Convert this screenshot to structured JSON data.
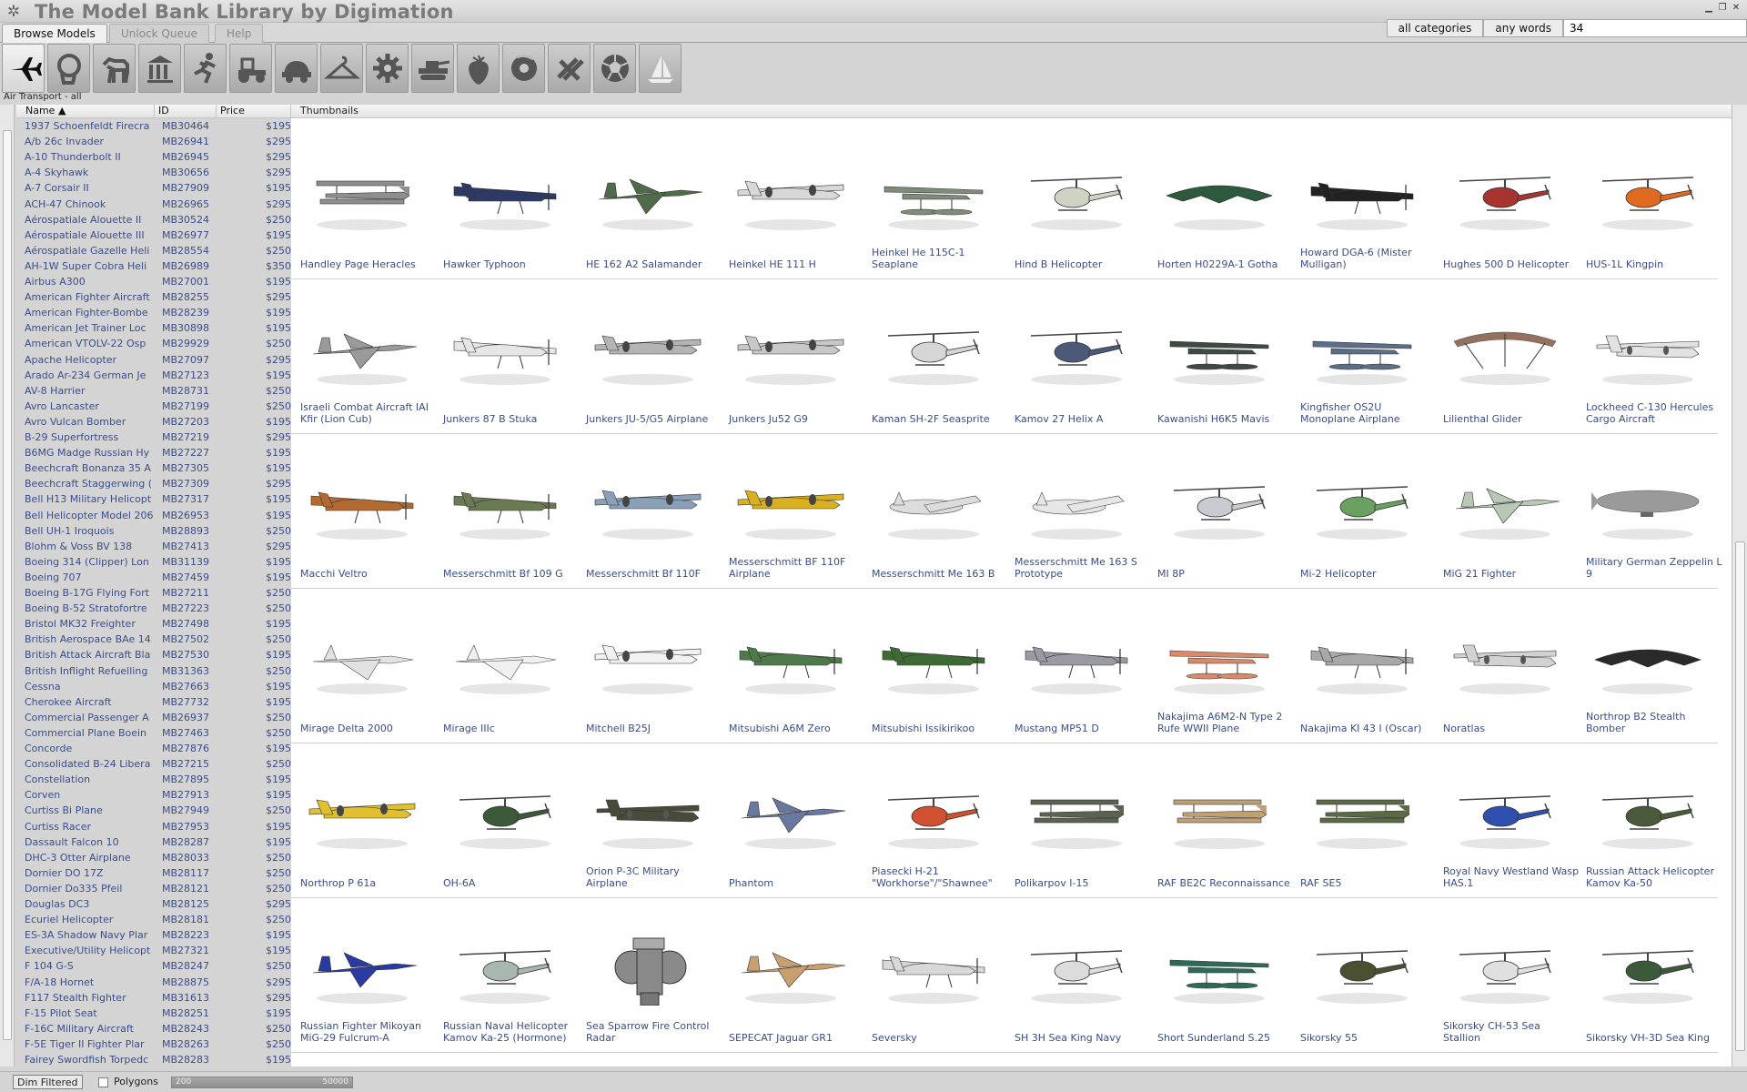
{
  "window": {
    "title": "The Model Bank Library by Digimation"
  },
  "tabs": [
    {
      "label": "Browse Models",
      "active": true
    },
    {
      "label": "Unlock Queue",
      "active": false
    },
    {
      "label": "Help",
      "active": false
    }
  ],
  "search": {
    "category": "all categories",
    "mode": "any words",
    "value": "34"
  },
  "categories": [
    {
      "icon": "airplane-icon",
      "active": true
    },
    {
      "icon": "head-icon"
    },
    {
      "icon": "horse-icon"
    },
    {
      "icon": "building-icon"
    },
    {
      "icon": "runner-icon"
    },
    {
      "icon": "tractor-icon"
    },
    {
      "icon": "car-icon"
    },
    {
      "icon": "hanger-icon"
    },
    {
      "icon": "gear-icon"
    },
    {
      "icon": "tank-icon"
    },
    {
      "icon": "strawberry-icon"
    },
    {
      "icon": "donut-icon"
    },
    {
      "icon": "tools-icon"
    },
    {
      "icon": "soccer-ball-icon"
    },
    {
      "icon": "sailboat-icon"
    }
  ],
  "category_caption": "Air Transport - all",
  "list": {
    "headers": {
      "name": "Name",
      "id": "ID",
      "price": "Price"
    },
    "rows": [
      [
        "1937 Schoenfeldt Firecra",
        "MB30464",
        "$195"
      ],
      [
        "A/b 26c Invader",
        "MB26941",
        "$295"
      ],
      [
        "A-10 Thunderbolt II",
        "MB26945",
        "$295"
      ],
      [
        "A-4 Skyhawk",
        "MB30656",
        "$295"
      ],
      [
        "A-7 Corsair II",
        "MB27909",
        "$195"
      ],
      [
        "ACH-47 Chinook",
        "MB26965",
        "$295"
      ],
      [
        "Aérospatiale Alouette II",
        "MB30524",
        "$250"
      ],
      [
        "Aérospatiale Alouette III",
        "MB26977",
        "$195"
      ],
      [
        "Aérospatiale Gazelle Heli",
        "MB28554",
        "$250"
      ],
      [
        "AH-1W Super Cobra Heli",
        "MB26989",
        "$350"
      ],
      [
        "Airbus A300",
        "MB27001",
        "$195"
      ],
      [
        "American Fighter Aircraft",
        "MB28255",
        "$295"
      ],
      [
        "American Fighter-Bombe",
        "MB28239",
        "$195"
      ],
      [
        "American Jet Trainer Loc",
        "MB30898",
        "$195"
      ],
      [
        "American VTOLV-22 Osp",
        "MB29929",
        "$250"
      ],
      [
        "Apache Helicopter",
        "MB27097",
        "$295"
      ],
      [
        "Arado Ar-234 German Je",
        "MB27123",
        "$195"
      ],
      [
        "AV-8 Harrier",
        "MB28731",
        "$250"
      ],
      [
        "Avro Lancaster",
        "MB27199",
        "$250"
      ],
      [
        "Avro Vulcan Bomber",
        "MB27203",
        "$195"
      ],
      [
        "B-29 Superfortress",
        "MB27219",
        "$295"
      ],
      [
        "B6MG Madge Russian Hy",
        "MB27227",
        "$195"
      ],
      [
        "Beechcraft Bonanza 35 A",
        "MB27305",
        "$195"
      ],
      [
        "Beechcraft Staggerwing (",
        "MB27309",
        "$295"
      ],
      [
        "Bell H13 Military Helicopt",
        "MB27317",
        "$195"
      ],
      [
        "Bell Helicopter Model 206",
        "MB26953",
        "$195"
      ],
      [
        "Bell UH-1 Iroquois",
        "MB28893",
        "$250"
      ],
      [
        "Blohm & Voss BV 138",
        "MB27413",
        "$295"
      ],
      [
        "Boeing 314 (Clipper) Lon",
        "MB31139",
        "$195"
      ],
      [
        "Boeing 707",
        "MB27459",
        "$195"
      ],
      [
        "Boeing B-17G Flying Fort",
        "MB27211",
        "$250"
      ],
      [
        "Boeing B-52 Stratofortre",
        "MB27223",
        "$250"
      ],
      [
        "Bristol MK32 Freighter",
        "MB27498",
        "$195"
      ],
      [
        "British Aerospace BAe 14",
        "MB27502",
        "$250"
      ],
      [
        "British Attack Aircraft Bla",
        "MB27530",
        "$195"
      ],
      [
        "British Inflight Refuelling",
        "MB31363",
        "$250"
      ],
      [
        "Cessna",
        "MB27663",
        "$195"
      ],
      [
        "Cherokee Aircraft",
        "MB27732",
        "$195"
      ],
      [
        "Commercial Passenger A",
        "MB26937",
        "$250"
      ],
      [
        "Commercial Plane Boein",
        "MB27463",
        "$250"
      ],
      [
        "Concorde",
        "MB27876",
        "$195"
      ],
      [
        "Consolidated B-24 Libera",
        "MB27215",
        "$250"
      ],
      [
        "Constellation",
        "MB27895",
        "$195"
      ],
      [
        "Corven",
        "MB27913",
        "$195"
      ],
      [
        "Curtiss Bi Plane",
        "MB27949",
        "$250"
      ],
      [
        "Curtiss Racer",
        "MB27953",
        "$195"
      ],
      [
        "Dassault Falcon 10",
        "MB28287",
        "$195"
      ],
      [
        "DHC-3 Otter Airplane",
        "MB28033",
        "$250"
      ],
      [
        "Dornier DO 17Z",
        "MB28117",
        "$250"
      ],
      [
        "Dornier Do335 Pfeil",
        "MB28121",
        "$250"
      ],
      [
        "Douglas DC3",
        "MB28125",
        "$295"
      ],
      [
        "Ecuriel Helicopter",
        "MB28181",
        "$250"
      ],
      [
        "ES-3A Shadow Navy Plar",
        "MB28223",
        "$195"
      ],
      [
        "Executive/Utility Helicopt",
        "MB27321",
        "$195"
      ],
      [
        "F 104 G-S",
        "MB28247",
        "$250"
      ],
      [
        "F/A-18 Hornet",
        "MB28875",
        "$295"
      ],
      [
        "F117 Stealth Fighter",
        "MB31613",
        "$295"
      ],
      [
        "F-15 Pilot Seat",
        "MB28251",
        "$195"
      ],
      [
        "F-16C Military Aircraft",
        "MB28243",
        "$250"
      ],
      [
        "F-5E Tiger II Fighter Plar",
        "MB28263",
        "$250"
      ],
      [
        "Fairey Swordfish Torpedc",
        "MB28283",
        "$195"
      ]
    ]
  },
  "gallery": {
    "header": "Thumbnails",
    "rows": [
      [
        {
          "label": "Handley Page Heracles",
          "icon": "biplane-icon",
          "color": "#8e8e8e"
        },
        {
          "label": "Hawker Typhoon",
          "icon": "fighter-icon",
          "color": "#2e3a66"
        },
        {
          "label": "HE 162 A2 Salamander",
          "icon": "jet-icon",
          "color": "#4f6b4a"
        },
        {
          "label": "Heinkel HE 111 H",
          "icon": "bomber-icon",
          "color": "#d8d8d8"
        },
        {
          "label": "Heinkel He 115C-1 Seaplane",
          "icon": "seaplane-icon",
          "color": "#7f8c7a"
        },
        {
          "label": "Hind B Helicopter",
          "icon": "helicopter-icon",
          "color": "#cfd3c4"
        },
        {
          "label": "Horten H0229A-1 Gotha",
          "icon": "flying-wing-icon",
          "color": "#2d5a3d"
        },
        {
          "label": "Howard DGA-6 (Mister Mulligan)",
          "icon": "fighter-icon",
          "color": "#222222"
        },
        {
          "label": "Hughes 500 D Helicopter",
          "icon": "helicopter-icon",
          "color": "#a8342f"
        },
        {
          "label": "HUS-1L Kingpin",
          "icon": "helicopter-icon",
          "color": "#e06a20"
        }
      ],
      [
        {
          "label": "Israeli Combat Aircraft IAI Kfir (Lion Cub)",
          "icon": "jet-icon",
          "color": "#9a9a9a"
        },
        {
          "label": "Junkers 87 B Stuka",
          "icon": "fighter-icon",
          "color": "#e6e6e6"
        },
        {
          "label": "Junkers JU-5/G5 Airplane",
          "icon": "bomber-icon",
          "color": "#b4b4b4"
        },
        {
          "label": "Junkers Ju52 G9",
          "icon": "bomber-icon",
          "color": "#c8c8c8"
        },
        {
          "label": "Kaman SH-2F Seasprite",
          "icon": "helicopter-icon",
          "color": "#d6d6d6"
        },
        {
          "label": "Kamov 27 Helix A",
          "icon": "helicopter-icon",
          "color": "#4a5a78"
        },
        {
          "label": "Kawanishi H6K5 Mavis",
          "icon": "seaplane-icon",
          "color": "#3f4a42"
        },
        {
          "label": "Kingfisher OS2U Monoplane Airplane",
          "icon": "seaplane-icon",
          "color": "#5d6e8a"
        },
        {
          "label": "Lilienthal Glider",
          "icon": "glider-icon",
          "color": "#7a4e38"
        },
        {
          "label": "Lockheed C-130 Hercules Cargo Aircraft",
          "icon": "cargo-plane-icon",
          "color": "#e2e2e2"
        }
      ],
      [
        {
          "label": "Macchi Veltro",
          "icon": "fighter-icon",
          "color": "#b26a30"
        },
        {
          "label": "Messerschmitt Bf 109 G",
          "icon": "fighter-icon",
          "color": "#6b7a52"
        },
        {
          "label": "Messerschmitt Bf 110F",
          "icon": "bomber-icon",
          "color": "#8aa0b8"
        },
        {
          "label": "Messerschmitt BF 110F Airplane",
          "icon": "bomber-icon",
          "color": "#d9b020"
        },
        {
          "label": "Messerschmitt Me 163 B",
          "icon": "rocket-plane-icon",
          "color": "#dcdcdc"
        },
        {
          "label": "Messerschmitt Me 163 S Prototype",
          "icon": "rocket-plane-icon",
          "color": "#e6e6e6"
        },
        {
          "label": "MI 8P",
          "icon": "helicopter-icon",
          "color": "#c8ccd0"
        },
        {
          "label": "Mi-2 Helicopter",
          "icon": "helicopter-icon",
          "color": "#6aa060"
        },
        {
          "label": "MiG 21 Fighter",
          "icon": "jet-icon",
          "color": "#b8c8b4"
        },
        {
          "label": "Military German Zeppelin L 9",
          "icon": "zeppelin-icon",
          "color": "#9a9a9a"
        }
      ],
      [
        {
          "label": "Mirage Delta 2000",
          "icon": "delta-jet-icon",
          "color": "#e2e2e2"
        },
        {
          "label": "Mirage IIIc",
          "icon": "delta-jet-icon",
          "color": "#f0f0f0"
        },
        {
          "label": "Mitchell B25J",
          "icon": "bomber-icon",
          "color": "#f2f2f2"
        },
        {
          "label": "Mitsubishi A6M Zero",
          "icon": "fighter-icon",
          "color": "#4e7a4a"
        },
        {
          "label": "Mitsubishi Issikirikoo",
          "icon": "fighter-icon",
          "color": "#3e6a34"
        },
        {
          "label": "Mustang MP51 D",
          "icon": "fighter-icon",
          "color": "#9a9aa2"
        },
        {
          "label": "Nakajima A6M2-N Type 2 Rufe WWII Plane",
          "icon": "seaplane-icon",
          "color": "#d88a6a"
        },
        {
          "label": "Nakajima KI 43 I (Oscar)",
          "icon": "fighter-icon",
          "color": "#a8a8a8"
        },
        {
          "label": "Noratlas",
          "icon": "cargo-plane-icon",
          "color": "#d2d2d2"
        },
        {
          "label": "Northrop B2 Stealth Bomber",
          "icon": "flying-wing-icon",
          "color": "#2a2a2a"
        }
      ],
      [
        {
          "label": "Northrop P 61a",
          "icon": "bomber-icon",
          "color": "#e0c030"
        },
        {
          "label": "OH-6A",
          "icon": "helicopter-icon",
          "color": "#3a5a3a"
        },
        {
          "label": "Orion P-3C  Military Airplane",
          "icon": "cargo-plane-icon",
          "color": "#4a4a3a"
        },
        {
          "label": "Phantom",
          "icon": "jet-icon",
          "color": "#6878a0"
        },
        {
          "label": "Piasecki H-21 \"Workhorse\"/\"Shawnee\"",
          "icon": "helicopter-icon",
          "color": "#d05030"
        },
        {
          "label": "Polikarpov I-15",
          "icon": "biplane-icon",
          "color": "#5a6250"
        },
        {
          "label": "RAF BE2C Reconnaissance",
          "icon": "biplane-icon",
          "color": "#c0a070"
        },
        {
          "label": "RAF SE5",
          "icon": "biplane-icon",
          "color": "#5a6a44"
        },
        {
          "label": "Royal Navy Westland Wasp HAS.1",
          "icon": "helicopter-icon",
          "color": "#3050b0"
        },
        {
          "label": "Russian Attack Helicopter Kamov Ka-50",
          "icon": "helicopter-icon",
          "color": "#4a5a3a"
        }
      ],
      [
        {
          "label": "Russian Fighter Mikoyan MiG-29 Fulcrum-A",
          "icon": "jet-icon",
          "color": "#2a3aa0"
        },
        {
          "label": "Russian Naval Helicopter Kamov Ka-25 (Hormone)",
          "icon": "helicopter-icon",
          "color": "#a8b8b0"
        },
        {
          "label": "Sea Sparrow Fire Control Radar",
          "icon": "radar-icon",
          "color": "#8a8a8a"
        },
        {
          "label": "SEPECAT Jaguar GR1",
          "icon": "jet-icon",
          "color": "#c8a070"
        },
        {
          "label": "Seversky",
          "icon": "fighter-icon",
          "color": "#d8d8d8"
        },
        {
          "label": "SH 3H Sea King Navy",
          "icon": "helicopter-icon",
          "color": "#dcdcdc"
        },
        {
          "label": "Short Sunderland S.25",
          "icon": "seaplane-icon",
          "color": "#2e6a58"
        },
        {
          "label": "Sikorsky 55",
          "icon": "helicopter-icon",
          "color": "#4a5030"
        },
        {
          "label": "Sikorsky CH-53 Sea Stallion",
          "icon": "helicopter-icon",
          "color": "#e0e0e0"
        },
        {
          "label": "Sikorsky VH-3D Sea King",
          "icon": "helicopter-icon",
          "color": "#3a5a3a"
        }
      ]
    ]
  },
  "status": {
    "dim_filtered": "Dim Filtered",
    "polygons_label": "Polygons",
    "poly_min": "200",
    "poly_max": "50000"
  }
}
